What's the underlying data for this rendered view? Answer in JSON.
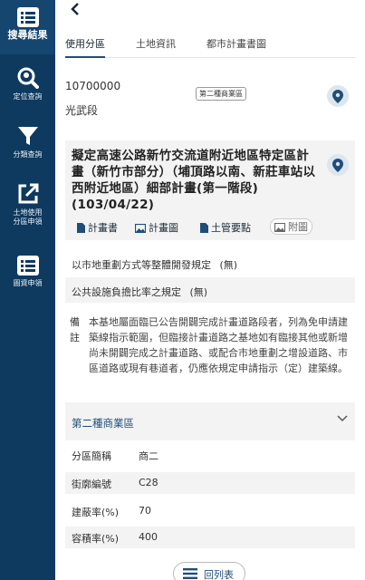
{
  "sidebar": {
    "items": [
      {
        "label": "搜尋結果",
        "icon": "list-icon"
      },
      {
        "label": "定位查詢",
        "icon": "location-search-icon"
      },
      {
        "label": "分類查詢",
        "icon": "filter-icon"
      },
      {
        "label": "土地使用\n分區申領",
        "icon": "external-link-icon"
      },
      {
        "label": "圖資申領",
        "icon": "list-icon"
      }
    ]
  },
  "header": {
    "back_icon": "chevron-left-icon"
  },
  "tabs": [
    {
      "label": "使用分區",
      "active": true
    },
    {
      "label": "土地資訊",
      "active": false
    },
    {
      "label": "都市計畫書圖",
      "active": false
    }
  ],
  "land": {
    "code": "10700000",
    "section": "光武段",
    "zone_badge": "第二種商業區"
  },
  "plan": {
    "title": "擬定高速公路新竹交流道附近地區特定區計畫（新竹市部分）（埔頂路以南、新莊車站以西附近地區）細部計畫(第一階段)(103/04/22)",
    "links": [
      "計畫書",
      "計畫圖",
      "土管要點",
      "附圖"
    ]
  },
  "rules": {
    "redevelopment": "以市地重劃方式等整體開發規定",
    "redevelopment_value": "(無)",
    "public_facility": "公共設施負擔比率之規定",
    "public_facility_value": "(無)"
  },
  "remark": {
    "label": "備註",
    "text": "本基地屬面臨已公告開闢完成計畫道路段者，列為免申請建築線指示範圍，但臨接計畫道路之基地如有臨接其他或新增尚未開闢完成之計畫道路、或配合市地重劃之增設道路、市區道路或現有巷道者，仍應依規定申請指示（定）建築線。"
  },
  "zone": {
    "title": "第二種商業區",
    "rows": [
      {
        "key": "分區簡稱",
        "value": "商二"
      },
      {
        "key": "街廓編號",
        "value": "C28"
      },
      {
        "key": "建蔽率(%)",
        "value": "70"
      },
      {
        "key": "容積率(%)",
        "value": "400"
      }
    ]
  },
  "footer": {
    "back_list_label": "回列表"
  },
  "colors": {
    "sidebar": "#0f3a5f",
    "accent": "#1f4e79",
    "panel": "#f3f3f3"
  }
}
